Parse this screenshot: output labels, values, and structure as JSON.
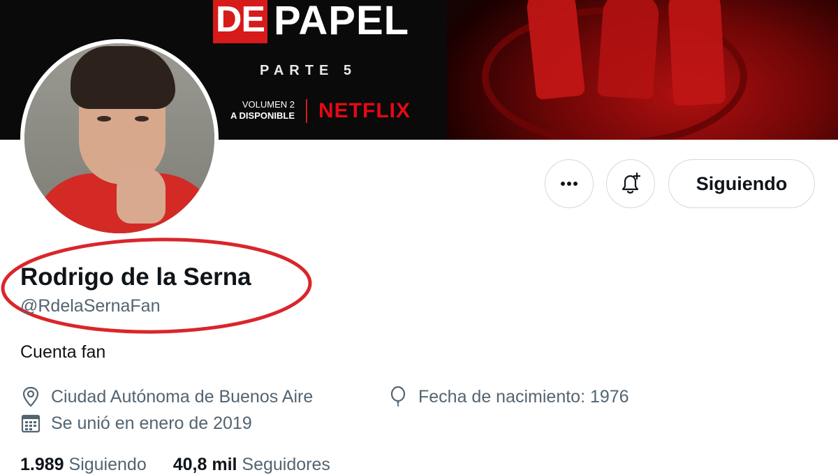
{
  "banner": {
    "logo_de": "DE",
    "logo_papel": "PAPEL",
    "parte": "PARTE 5",
    "volumen": "VOLUMEN 2",
    "disponible": "A DISPONIBLE",
    "netflix": "NETFLIX"
  },
  "actions": {
    "more_icon": "more-dots-icon",
    "bell_icon": "bell-plus-icon",
    "follow_label": "Siguiendo"
  },
  "profile": {
    "name": "Rodrigo de la Serna",
    "handle": "@RdelaSernaFan",
    "bio": "Cuenta fan",
    "location": "Ciudad Autónoma de Buenos Aire",
    "birth": "Fecha de nacimiento: 1976",
    "joined": "Se unió en enero de 2019"
  },
  "stats": {
    "following_count": "1.989",
    "following_label": "Siguiendo",
    "followers_count": "40,8 mil",
    "followers_label": "Seguidores"
  },
  "colors": {
    "highlight": "#d9262b",
    "muted_text": "#536471",
    "primary_text": "#0f1419",
    "border": "#cfd9de"
  }
}
